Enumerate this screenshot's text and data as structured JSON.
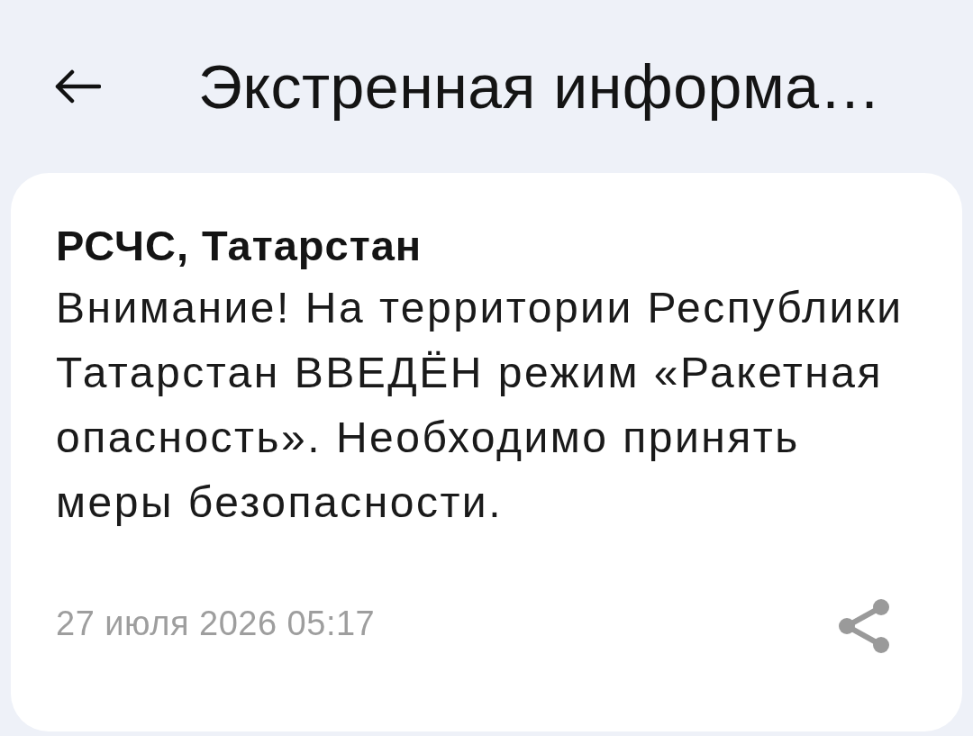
{
  "header": {
    "title": "Экстренная информа…"
  },
  "alert": {
    "source": "РСЧС, Татарстан",
    "message": "Внимание! На территории Республики Татарстан ВВЕДЁН режим «Ракетная опасность». Необходимо принять меры безопасности.",
    "timestamp": "27 июля 2026 05:17"
  }
}
